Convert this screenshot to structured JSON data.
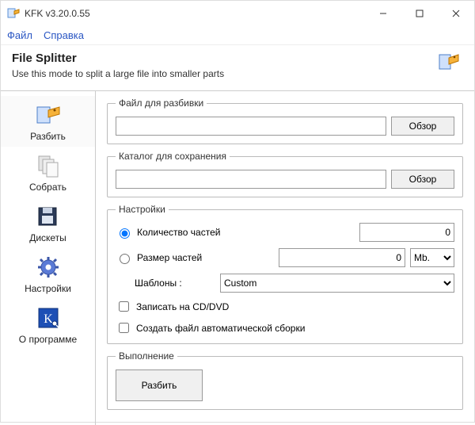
{
  "window": {
    "title": "KFK v3.20.0.55"
  },
  "menu": {
    "file": "Файл",
    "help": "Справка"
  },
  "header": {
    "title": "File Splitter",
    "subtitle": "Use this mode to split a large file into smaller parts"
  },
  "sidebar": {
    "items": [
      {
        "label": "Разбить",
        "icon": "split"
      },
      {
        "label": "Собрать",
        "icon": "merge"
      },
      {
        "label": "Дискеты",
        "icon": "floppy"
      },
      {
        "label": "Настройки",
        "icon": "gear"
      },
      {
        "label": "О программе",
        "icon": "about"
      }
    ]
  },
  "groups": {
    "file_to_split": {
      "legend": "Файл для разбивки",
      "value": "",
      "browse": "Обзор"
    },
    "save_dir": {
      "legend": "Каталог для сохранения",
      "value": "",
      "browse": "Обзор"
    },
    "settings": {
      "legend": "Настройки",
      "count_label": "Количество частей",
      "count_value": "0",
      "size_label": "Размер частей",
      "size_value": "0",
      "size_unit": "Mb.",
      "templates_label": "Шаблоны :",
      "template_value": "Custom",
      "cd_dvd": "Записать на CD/DVD",
      "autofile": "Создать файл автоматической сборки"
    },
    "execution": {
      "legend": "Выполнение",
      "split": "Разбить"
    }
  }
}
